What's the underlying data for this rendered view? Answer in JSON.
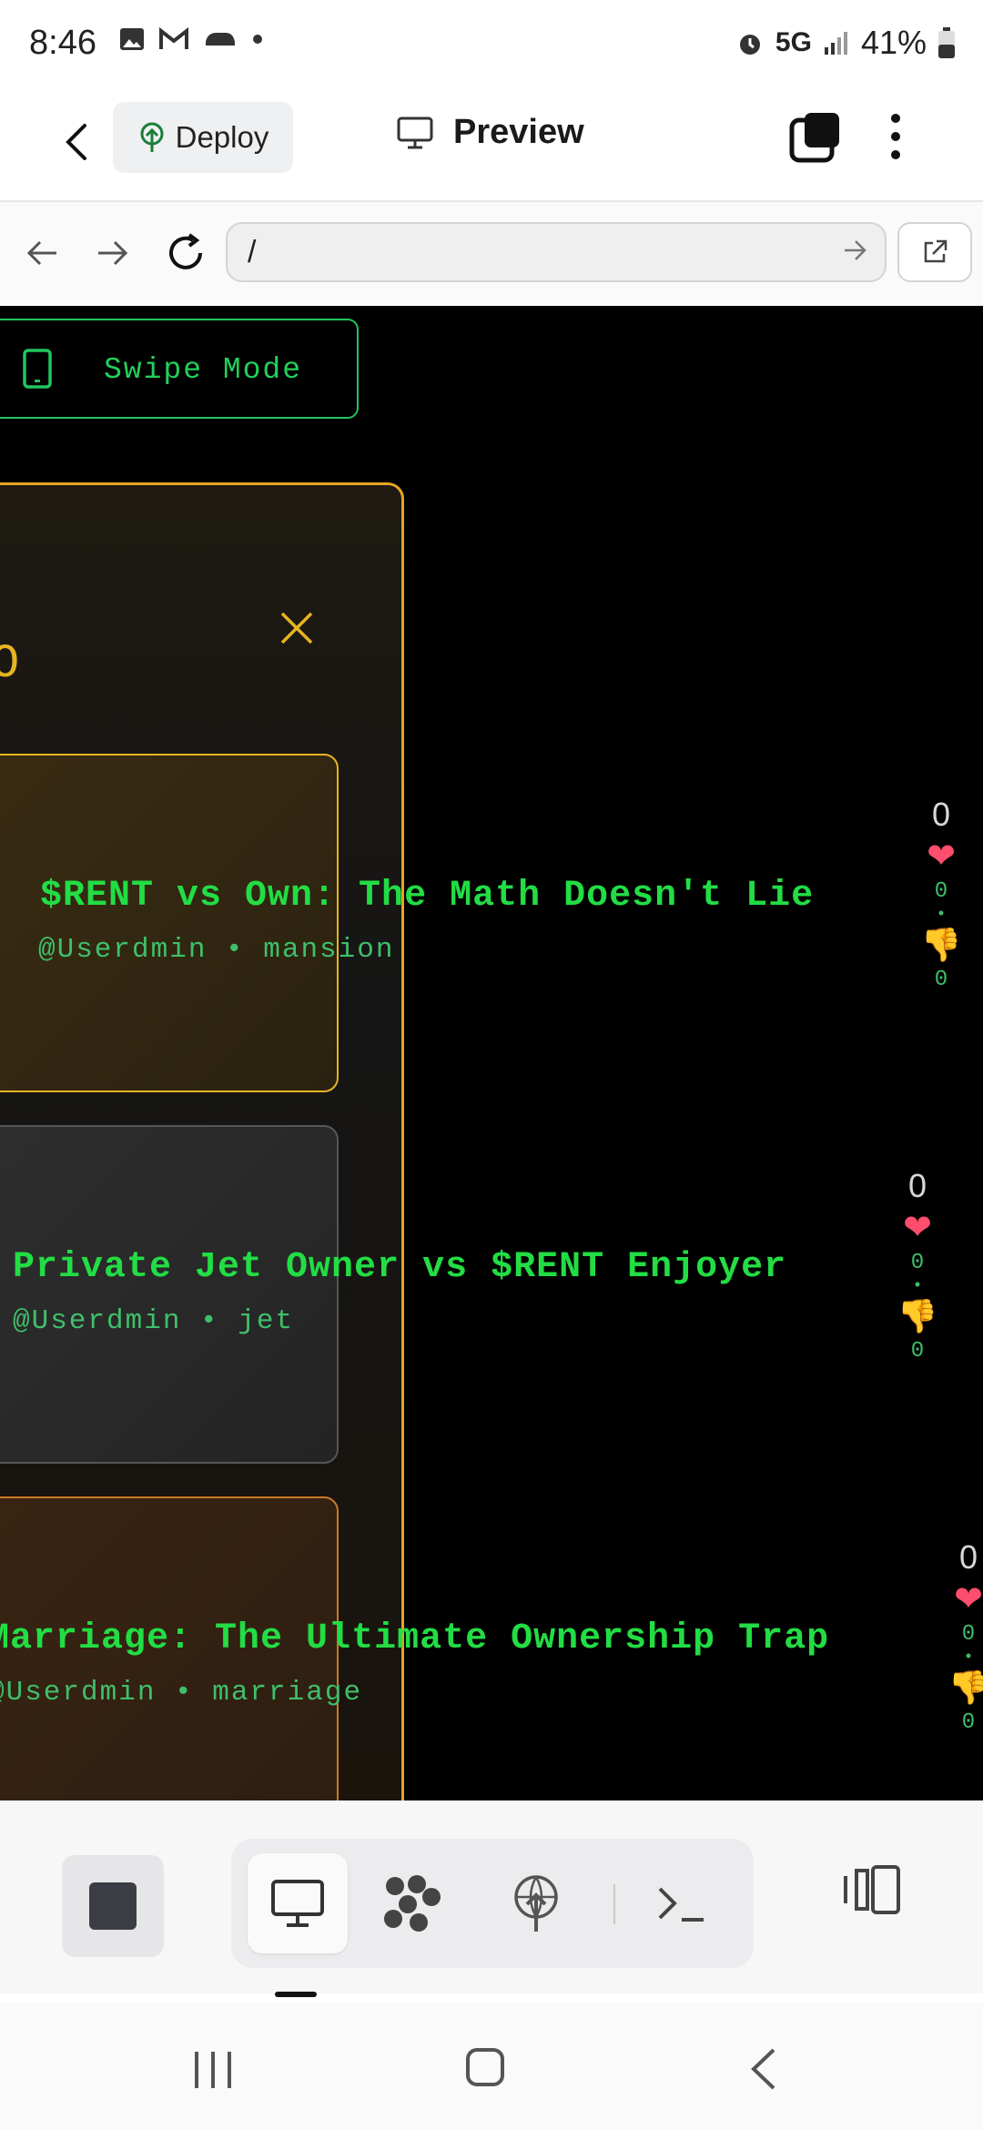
{
  "status_bar": {
    "time": "8:46",
    "network": "5G",
    "battery": "41%"
  },
  "app_bar": {
    "deploy_label": "Deploy",
    "title": "Preview"
  },
  "browser": {
    "url": "/"
  },
  "webview": {
    "swipe_mode_label": "Swipe Mode",
    "panel_title_fragment": "O",
    "posts": [
      {
        "title": "$RENT vs Own: The Math Doesn't Lie",
        "meta": "@Userdmin • mansion",
        "score": "0",
        "likes": "0",
        "dislikes": "0"
      },
      {
        "title": "Private Jet Owner vs $RENT Enjoyer",
        "meta": "@Userdmin • jet",
        "score": "0",
        "likes": "0",
        "dislikes": "0"
      },
      {
        "title": "Marriage: The Ultimate Ownership Trap",
        "meta": "@Userdmin • marriage",
        "score": "0",
        "likes": "0",
        "dislikes": "0"
      }
    ]
  },
  "colors": {
    "accent_green": "#22dd44",
    "panel_border": "#e6a520",
    "webview_bg": "#000000"
  },
  "icons": [
    "back-icon",
    "deploy-icon",
    "monitor-icon",
    "tabs-icon",
    "more-icon",
    "arrow-left-icon",
    "arrow-right-icon",
    "reload-icon",
    "go-icon",
    "external-link-icon",
    "phone-icon",
    "close-icon",
    "heart-icon",
    "thumbs-down-icon",
    "stop-icon",
    "preview-icon",
    "assets-icon",
    "deploy-icon",
    "terminal-icon",
    "split-view-icon"
  ]
}
